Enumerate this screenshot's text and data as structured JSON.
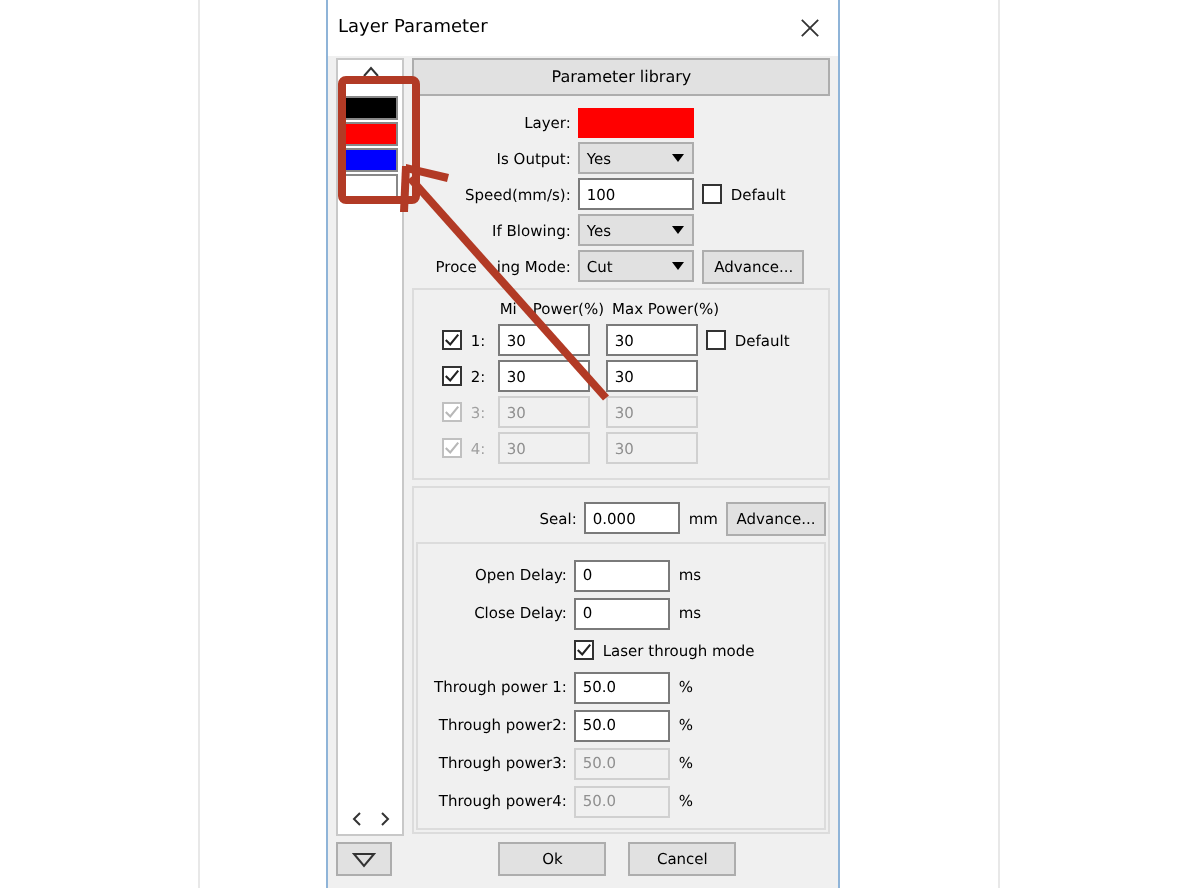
{
  "window": {
    "title": "Layer Parameter"
  },
  "layers": [
    {
      "color": "#000000"
    },
    {
      "color": "#ff0000"
    },
    {
      "color": "#0000ff"
    },
    {
      "color": "#ffffff"
    }
  ],
  "parameter_library_button": "Parameter library",
  "layer": {
    "label": "Layer:",
    "color": "#ff0000"
  },
  "is_output": {
    "label": "Is Output:",
    "value": "Yes"
  },
  "speed": {
    "label": "Speed(mm/s):",
    "value": "100",
    "default_label": "Default",
    "default_checked": false
  },
  "if_blowing": {
    "label": "If Blowing:",
    "value": "Yes"
  },
  "processing_mode": {
    "label_parts": [
      "Proce",
      "ing Mode:"
    ],
    "value": "Cut",
    "button": "Advance..."
  },
  "power": {
    "min_header_parts": [
      "Mi",
      "Power(%)"
    ],
    "max_header": "Max Power(%)",
    "default_label": "Default",
    "default_checked": false,
    "rows": [
      {
        "label": "1:",
        "checked": true,
        "disabled": false,
        "min": "30",
        "max": "30"
      },
      {
        "label": "2:",
        "checked": true,
        "disabled": false,
        "min": "30",
        "max": "30"
      },
      {
        "label": "3:",
        "checked": true,
        "disabled": true,
        "min": "30",
        "max": "30"
      },
      {
        "label": "4:",
        "checked": true,
        "disabled": true,
        "min": "30",
        "max": "30"
      }
    ]
  },
  "seal": {
    "label": "Seal:",
    "value": "0.000",
    "unit": "mm",
    "button": "Advance..."
  },
  "delays": [
    {
      "label": "Open Delay:",
      "value": "0",
      "unit": "ms"
    },
    {
      "label": "Close Delay:",
      "value": "0",
      "unit": "ms"
    }
  ],
  "laser_through": {
    "label": "Laser through mode",
    "checked": true
  },
  "through_power": [
    {
      "label": "Through power 1:",
      "value": "50.0",
      "unit": "%",
      "disabled": false
    },
    {
      "label": "Through power2:",
      "value": "50.0",
      "unit": "%",
      "disabled": false
    },
    {
      "label": "Through power3:",
      "value": "50.0",
      "unit": "%",
      "disabled": true
    },
    {
      "label": "Through power4:",
      "value": "50.0",
      "unit": "%",
      "disabled": true
    }
  ],
  "buttons": [
    {
      "label": "Ok"
    },
    {
      "label": "Cancel"
    }
  ]
}
